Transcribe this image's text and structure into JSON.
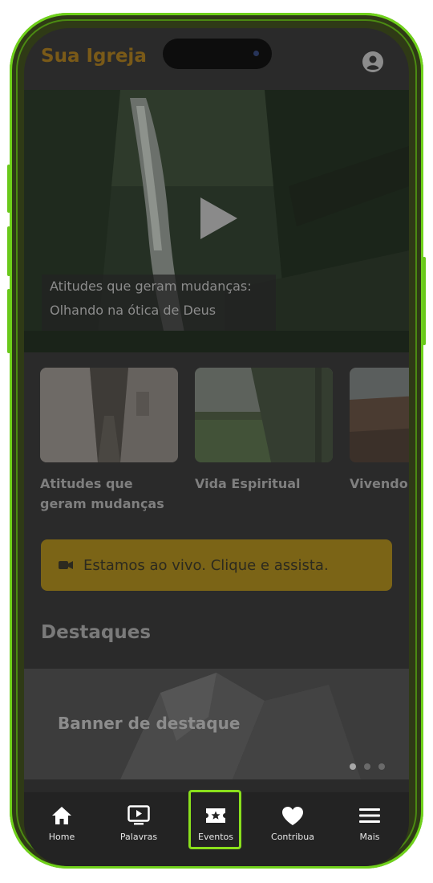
{
  "app": {
    "title": "Sua Igreja"
  },
  "hero": {
    "caption_line1": "Atitudes que geram mudanças:",
    "caption_line2": "Olhando na ótica de Deus"
  },
  "cards": [
    {
      "title": "Atitudes que geram mudanças"
    },
    {
      "title": "Vida Espiritual"
    },
    {
      "title": "Vivendo propósit"
    }
  ],
  "live_banner": {
    "label": "Estamos ao vivo. Clique e assista."
  },
  "section": {
    "title": "Destaques"
  },
  "highlight_banner": {
    "label": "Banner de destaque"
  },
  "tabbar": {
    "items": [
      {
        "label": "Home",
        "icon": "home-icon"
      },
      {
        "label": "Palavras",
        "icon": "tv-play-icon"
      },
      {
        "label": "Eventos",
        "icon": "ticket-star-icon"
      },
      {
        "label": "Contribua",
        "icon": "heart-icon"
      },
      {
        "label": "Mais",
        "icon": "menu-icon"
      }
    ]
  },
  "colors": {
    "frame_accent": "#6fd11b",
    "brand": "#7a5a18",
    "live_banner": "#7b6416",
    "tabbar_bg": "#232323"
  }
}
